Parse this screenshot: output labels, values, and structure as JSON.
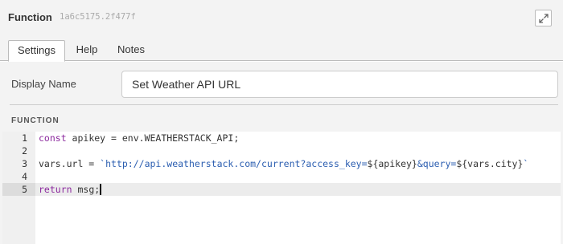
{
  "header": {
    "title": "Function",
    "node_id": "1a6c5175.2f477f"
  },
  "tabs": [
    {
      "label": "Settings",
      "active": true
    },
    {
      "label": "Help",
      "active": false
    },
    {
      "label": "Notes",
      "active": false
    }
  ],
  "form": {
    "display_name_label": "Display Name",
    "display_name_value": "Set Weather API URL",
    "section_label": "FUNCTION"
  },
  "editor": {
    "line_numbers": [
      "1",
      "2",
      "3",
      "4",
      "5"
    ],
    "active_line": 5,
    "line1": {
      "kw": "const",
      "rest": " apikey = env.WEATHERSTACK_API;"
    },
    "line3": {
      "pre": "vars.url = ",
      "tick_open": "`",
      "url_part1": "http://api.weatherstack.com/current?access_key=",
      "interp1": "${apikey}",
      "url_part2": "&query=",
      "interp2": "${vars.city}",
      "tick_close": "`"
    },
    "line5": {
      "kw": "return",
      "rest": " msg;"
    }
  },
  "colors": {
    "keyword": "#8c2a9e",
    "string": "#2a5db0",
    "panel_background": "#f3f3f3"
  },
  "icons": {
    "expand": "expand-arrows-icon"
  }
}
